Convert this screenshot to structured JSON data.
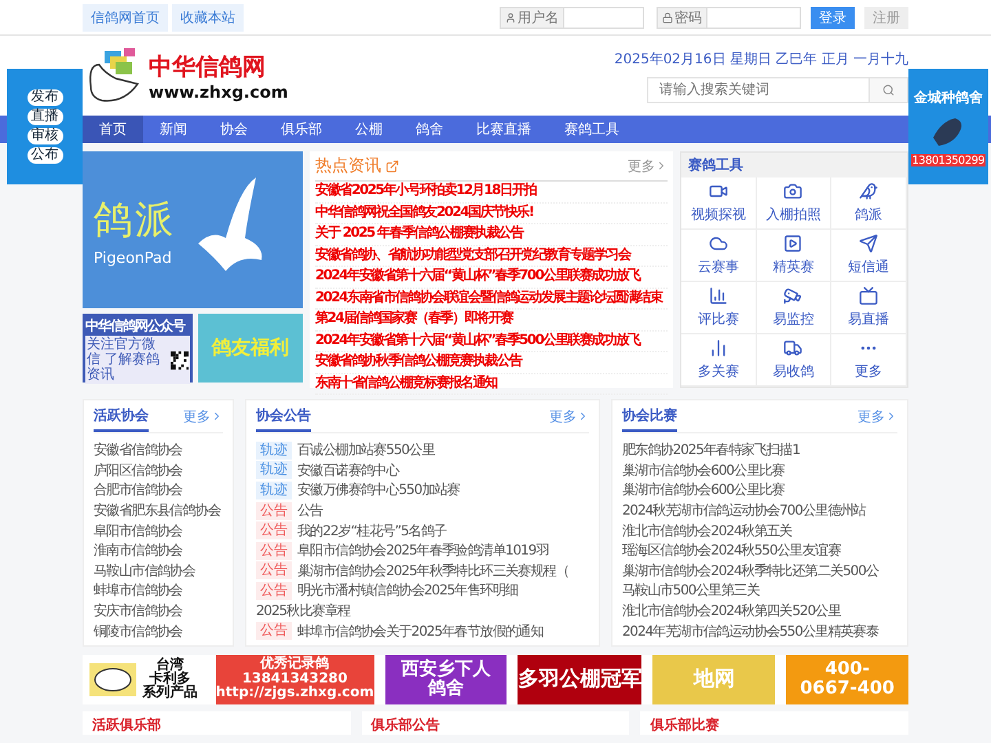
{
  "top_links": [
    "信鸽网首页",
    "收藏本站"
  ],
  "login": {
    "username_label": "用户名",
    "password_label": "密码",
    "login_button": "登录",
    "register_button": "注册"
  },
  "header": {
    "site_name": "中华信鸽网",
    "site_url": "www.zhxg.com",
    "date": "2025年02月16日 星期日 乙巳年 正月 一月十九",
    "search": {
      "placeholder": "请输入搜索关键词"
    }
  },
  "nav": [
    {
      "label": "首页",
      "selected": true
    },
    {
      "label": "新闻",
      "selected": false
    },
    {
      "label": "协会",
      "selected": false
    },
    {
      "label": "俱乐部",
      "selected": false
    },
    {
      "label": "公棚",
      "selected": false
    },
    {
      "label": "鸽舍",
      "selected": false
    },
    {
      "label": "比赛直播",
      "selected": false
    },
    {
      "label": "赛鸽工具",
      "selected": false
    }
  ],
  "side_ads": {
    "left": [
      "发布",
      "直播",
      "审核",
      "公布"
    ],
    "right": {
      "title": "金城种鸽舍",
      "phone": "13801350299"
    }
  },
  "banners": {
    "main": {
      "title": "鸽派",
      "subtitle": "PigeonPad"
    },
    "wechat": {
      "title": "中华信鸽网公众号",
      "text": "关注官方微信 了解赛鸽资讯"
    },
    "welfare": {
      "title": "鸽友福利"
    }
  },
  "hot_news": {
    "title": "热点资讯",
    "more": "更多",
    "items": [
      "安徽省2025年小号环拍卖12月18日开拍",
      "中华信鸽网祝全国鸽友2024国庆节快乐!",
      "关于 2025 年春季信鸽公棚赛执裁公告",
      "安徽省鸽协、省航协功能型党支部召开党纪教育专题学习会",
      "2024年安徽省第十六届“黄山杯”春季700公里联赛成功放飞",
      "2024东南省市信鸽协会联谊会暨信鸽运动发展主题论坛圆满结束",
      "第24届信鸽国家赛（春季）即将开赛",
      "2024年安徽省第十六届“黄山杯”春季500公里联赛成功放飞",
      "安徽省鸽协秋季信鸽公棚竞赛执裁公告",
      "东南十省信鸽公棚竞标赛报名通知"
    ]
  },
  "tools": {
    "title": "赛鸽工具",
    "items": [
      "视频探视",
      "入棚拍照",
      "鸽派",
      "云赛事",
      "精英赛",
      "短信通",
      "评比赛",
      "易监控",
      "易直播",
      "多关赛",
      "易收鸽",
      "更多"
    ]
  },
  "panels": [
    {
      "title": "活跃协会",
      "more": "更多",
      "items": [
        "安徽省信鸽协会",
        "庐阳区信鸽协会",
        "合肥市信鸽协会",
        "安徽省肥东县信鸽协会",
        "阜阳市信鸽协会",
        "淮南市信鸽协会",
        "马鞍山市信鸽协会",
        "蚌埠市信鸽协会",
        "安庆市信鸽协会",
        "铜陵市信鸽协会"
      ]
    },
    {
      "title": "协会公告",
      "more": "更多",
      "items": [
        {
          "kind": "track",
          "tag": "轨迹",
          "text": "百诚公棚加站赛550公里"
        },
        {
          "kind": "track",
          "tag": "轨迹",
          "text": "安徽百诺赛鸽中心"
        },
        {
          "kind": "track",
          "tag": "轨迹",
          "text": "安徽万佛赛鸽中心550加站赛"
        },
        {
          "kind": "notice",
          "tag": "公告",
          "text": "公告"
        },
        {
          "kind": "notice",
          "tag": "公告",
          "text": "我的22岁“桂花号”5名鸽子"
        },
        {
          "kind": "notice",
          "tag": "公告",
          "text": "阜阳市信鸽协会2025年春季验鸽清单1019羽"
        },
        {
          "kind": "notice",
          "tag": "公告",
          "text": "巢湖市信鸽协会2025年秋季特比环三关赛规程（"
        },
        {
          "kind": "notice",
          "tag": "公告",
          "text": "明光市潘村镇信鸽协会2025年售环明细"
        },
        {
          "kind": "plain",
          "text": "2025秋比赛章程"
        },
        {
          "kind": "notice",
          "tag": "公告",
          "text": "蚌埠市信鸽协会关于2025年春节放假的通知"
        }
      ]
    },
    {
      "title": "协会比赛",
      "more": "更多",
      "items": [
        "肥东鸽协2025年春特家飞扫描1",
        "巢湖市信鸽协会600公里比赛",
        "巢湖市信鸽协会600公里比赛",
        "2024秋芜湖市信鸽运动协会700公里德州站",
        "淮北市信鸽协会2024秋第五关",
        "瑶海区信鸽协会2024秋550公里友谊赛",
        "巢湖市信鸽协会2024秋季特比还第二关500公",
        "马鞍山市500公里第三关",
        "淮北市信鸽协会2024秋第四关520公里",
        "2024年芜湖市信鸽运动协会550公里精英赛泰"
      ]
    }
  ],
  "ads": [
    {
      "kind": "logo",
      "color": "#ffffff",
      "lines": [
        "台湾",
        "卡利多",
        "系列产品"
      ]
    },
    {
      "kind": "text",
      "color": "#e8443a",
      "lines": [
        "优秀记录鸽",
        "13841343280",
        "http://zjgs.zhxg.com"
      ]
    },
    {
      "kind": "text",
      "color": "#8a2fc0",
      "lines": [
        "西安乡下人",
        "鸽舍"
      ]
    },
    {
      "kind": "text",
      "color": "#b0000e",
      "lines": [
        "多羽公棚冠军"
      ]
    },
    {
      "kind": "text",
      "color": "#e9c84a",
      "lines": [
        "地网"
      ]
    },
    {
      "kind": "text",
      "color": "#f39a10",
      "lines": [
        "400-",
        "0667-400"
      ]
    }
  ],
  "bottom_panels": [
    "活跃俱乐部",
    "俱乐部公告",
    "俱乐部比赛"
  ]
}
